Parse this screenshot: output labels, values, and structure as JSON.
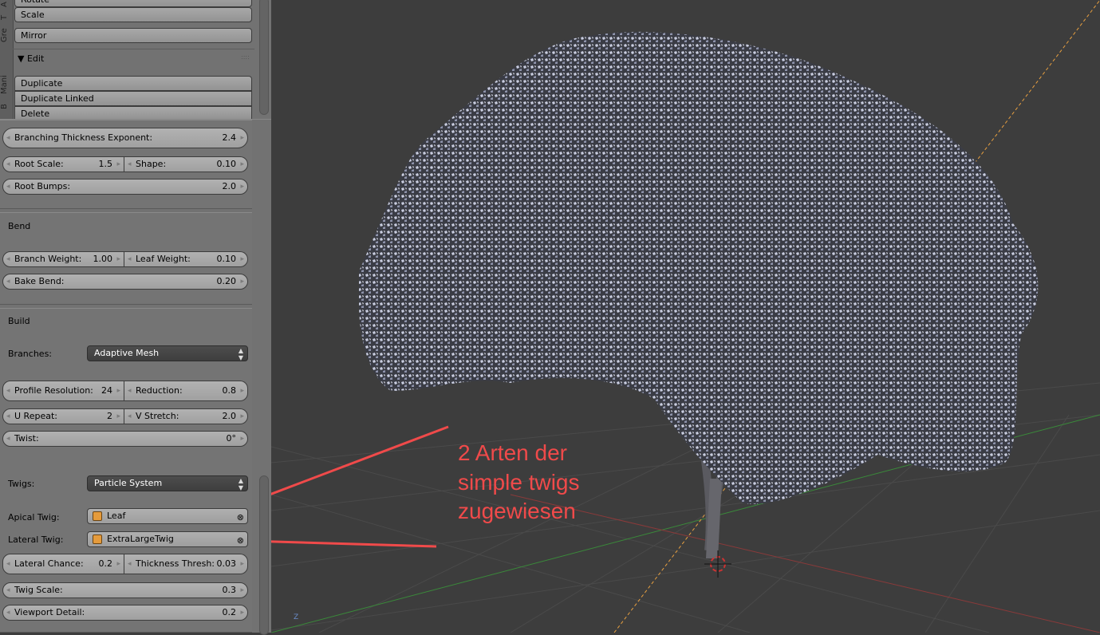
{
  "toolbar": {
    "tabs": [
      "A",
      "T",
      "Gre",
      "Mani",
      "B"
    ],
    "buttons": [
      "Rotate",
      "Scale",
      "Mirror"
    ],
    "edit_header": "Edit",
    "edit_buttons": [
      "Duplicate",
      "Duplicate Linked",
      "Delete"
    ]
  },
  "shape": {
    "branching_thickness_exponent": {
      "label": "Branching Thickness Exponent:",
      "value": "2.4"
    },
    "root_scale": {
      "label": "Root Scale:",
      "value": "1.5"
    },
    "shape": {
      "label": "Shape:",
      "value": "0.10"
    },
    "root_bumps": {
      "label": "Root Bumps:",
      "value": "2.0"
    }
  },
  "bend": {
    "title": "Bend",
    "branch_weight": {
      "label": "Branch Weight:",
      "value": "1.00"
    },
    "leaf_weight": {
      "label": "Leaf Weight:",
      "value": "0.10"
    },
    "bake_bend": {
      "label": "Bake Bend:",
      "value": "0.20"
    }
  },
  "build": {
    "title": "Build",
    "branches_label": "Branches:",
    "branches_value": "Adaptive Mesh",
    "profile_resolution": {
      "label": "Profile Resolution:",
      "value": "24"
    },
    "reduction": {
      "label": "Reduction:",
      "value": "0.8"
    },
    "u_repeat": {
      "label": "U Repeat:",
      "value": "2"
    },
    "v_stretch": {
      "label": "V Stretch:",
      "value": "2.0"
    },
    "twist": {
      "label": "Twist:",
      "value": "0°"
    },
    "twigs_label": "Twigs:",
    "twigs_value": "Particle System",
    "apical_label": "Apical Twig:",
    "apical_value": "Leaf",
    "lateral_label": "Lateral Twig:",
    "lateral_value": "ExtraLargeTwig",
    "lateral_chance": {
      "label": "Lateral Chance:",
      "value": "0.2"
    },
    "thickness_thresh": {
      "label": "Thickness Thresh:",
      "value": "0.03"
    },
    "twig_scale": {
      "label": "Twig Scale:",
      "value": "0.3"
    },
    "viewport_detail": {
      "label": "Viewport Detail:",
      "value": "0.2"
    }
  },
  "annotation": {
    "lines": [
      "2 Arten der",
      "simple twigs",
      "zugewiesen"
    ],
    "color": "#f04a4a"
  },
  "viewport": {
    "axis_label": "Z"
  }
}
